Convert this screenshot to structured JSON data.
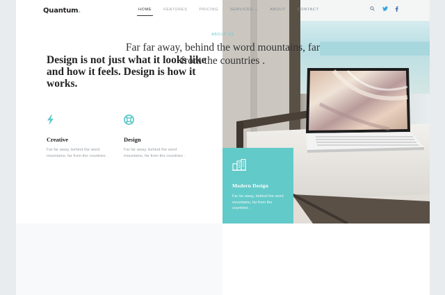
{
  "brand": {
    "name": "Quantum",
    "dot": "."
  },
  "nav": [
    {
      "label": "HOME"
    },
    {
      "label": "FEATURES"
    },
    {
      "label": "PRICING"
    },
    {
      "label": "SERVICES ⌄"
    },
    {
      "label": "ABOUT"
    },
    {
      "label": "CONTACT"
    }
  ],
  "social": {
    "search": "search-icon",
    "twitter": "twitter-icon",
    "facebook": "facebook-icon"
  },
  "hero": {
    "title": "Design is not just what it looks like and how it feels. Design is how it works."
  },
  "features": [
    {
      "icon": "lightning-icon",
      "title": "Creative",
      "text": "Far far away, behind the word mountains, far from the countries ."
    },
    {
      "icon": "lifebuoy-icon",
      "title": "Design",
      "text": "Far far away, behind the word mountains, far from the countries ."
    }
  ],
  "highlight": {
    "icon": "buildings-icon",
    "title": "Modern Design",
    "text": "Far far away, behind the word mountains, far from the countries ."
  },
  "about": {
    "label": "ABOUT US",
    "text": "Far far away, behind the word mountains, far from the countries ."
  },
  "colors": {
    "accent": "#62cac9",
    "dark": "#222222",
    "muted": "#9aa0a6"
  }
}
